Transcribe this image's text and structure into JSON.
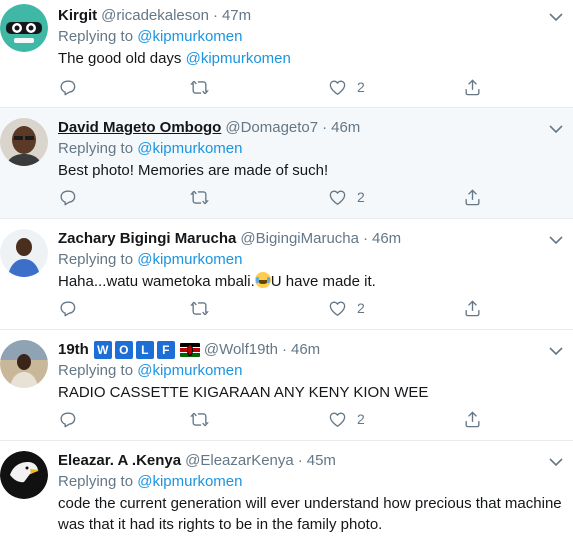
{
  "tweets": [
    {
      "name": "Kirgit",
      "handle": "@ricadekaleson",
      "time": "47m",
      "replying_prefix": "Replying to ",
      "replying_to": "@kipmurkomen",
      "text": "The good old days ",
      "text_mention": "@kipmurkomen",
      "likes": "2"
    },
    {
      "name": "David Mageto Ombogo",
      "handle": "@Domageto7",
      "time": "46m",
      "replying_prefix": "Replying to ",
      "replying_to": "@kipmurkomen",
      "text": "Best photo! Memories are made of such!",
      "likes": "2"
    },
    {
      "name": "Zachary Bigingi Marucha",
      "handle": "@BigingiMarucha",
      "time": "46m",
      "replying_prefix": "Replying to ",
      "replying_to": "@kipmurkomen",
      "text": "Haha...watu wametoka mbali.",
      "text_after_emoji": "U have made it.",
      "likes": "2"
    },
    {
      "name": "19th",
      "name_badges": [
        "W",
        "O",
        "L",
        "F"
      ],
      "handle": "@Wolf19th",
      "time": "46m",
      "replying_prefix": "Replying to ",
      "replying_to": "@kipmurkomen",
      "text": "RADIO CASSETTE KIGARAAN ANY KENY KION WEE",
      "likes": "2"
    },
    {
      "name": "Eleazar. A .Kenya",
      "handle": "@EleazarKenya",
      "time": "45m",
      "replying_prefix": "Replying to ",
      "replying_to": "@kipmurkomen",
      "text": "code the current generation will ever understand how precious that machine was that it had its rights to be in the family photo."
    }
  ],
  "separator": "·",
  "icons": [
    "reply-icon",
    "retweet-icon",
    "like-icon",
    "share-icon",
    "chevron-down-icon"
  ],
  "colors": {
    "link": "#1b95e0",
    "muted": "#657786",
    "hover_bg": "#f5f8fa",
    "divider": "#e6ecf0"
  }
}
